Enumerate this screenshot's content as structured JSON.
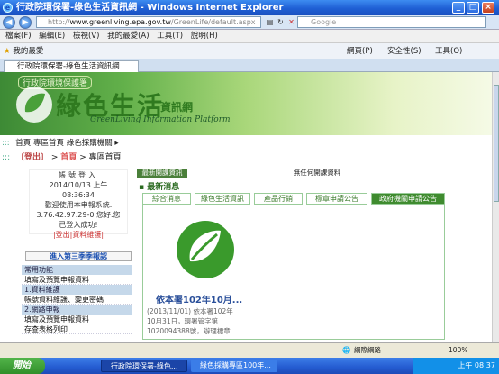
{
  "window": {
    "title": "行政院環保署-綠色生活資訊網 - Windows Internet Explorer",
    "min": "_",
    "max": "□",
    "close": "×"
  },
  "address": {
    "prefix": "http://",
    "host": "www.greenliving.epa.gov.tw",
    "path": "/GreenLife/default.aspx",
    "search_placeholder": "Google"
  },
  "menu": [
    "檔案(F)",
    "編輯(E)",
    "檢視(V)",
    "我的最愛(A)",
    "工具(T)",
    "說明(H)"
  ],
  "favbar": {
    "favorites": "我的最愛",
    "right_items": [
      "網頁(P)",
      "安全性(S)",
      "工具(O)"
    ]
  },
  "tab": {
    "label": "行政院環保署-綠色生活資訊網"
  },
  "banner": {
    "org": "行政院環境保護署",
    "title": "綠色生活",
    "title_suffix": "資訊網",
    "english": "GreenLiving Information Platform"
  },
  "topnav": {
    "dots": ":::",
    "links": "首頁 專區首頁 綠色採購機關"
  },
  "breadcrumb": {
    "dots": ":::",
    "login": "〔登出〕",
    "sep1": ">",
    "home": "首頁",
    "sep2": ">",
    "current": "專區首頁"
  },
  "login": {
    "heading": "帳號登入",
    "date": "2014/10/13 上午",
    "time": "08:36:34",
    "welcome": "歡迎使用本申報系統.",
    "ip": "3.76.42.97.29-0 您好.您",
    "success": "已登入成功!",
    "links": "|登出|資料維護|"
  },
  "vote": "進入第三季季報認",
  "menu_sections": [
    {
      "label": "常用功能",
      "kind": "h"
    },
    {
      "label": "填寫及預覽申報資料",
      "kind": "i"
    },
    {
      "label": "1.資料維護",
      "kind": "h"
    },
    {
      "label": "帳號資料維護、變更密碼",
      "kind": "i"
    },
    {
      "label": "2.網路申報",
      "kind": "h"
    },
    {
      "label": "填寫及預覽申報資料",
      "kind": "i"
    },
    {
      "label": "存查表格列印",
      "kind": "i"
    }
  ],
  "news": {
    "bar_label": "最新開課資訊",
    "bar_text": "無任何開課資料",
    "latest": "最新消息",
    "tabs": [
      "綜合消息",
      "綠色生活資訊",
      "產品行銷",
      "標章申請公告",
      "政府機關申請公告"
    ],
    "active_tab": 4,
    "item_title": "依本署102年10月...",
    "item_desc": [
      "(2013/11/01) 依本署102年",
      "10月31日，環署管字第",
      "1020094388號，辦理標章..."
    ]
  },
  "status": {
    "zone": "網際網路",
    "zoom": "100%"
  },
  "taskbar": {
    "start": "開始",
    "tasks": [
      "行政院環保署-綠色...",
      "綠色採購專區100年..."
    ],
    "clock": "上午 08:37"
  },
  "colors": {
    "brand_green": "#3f8b2f",
    "title_blue": "#1f5fd4"
  }
}
